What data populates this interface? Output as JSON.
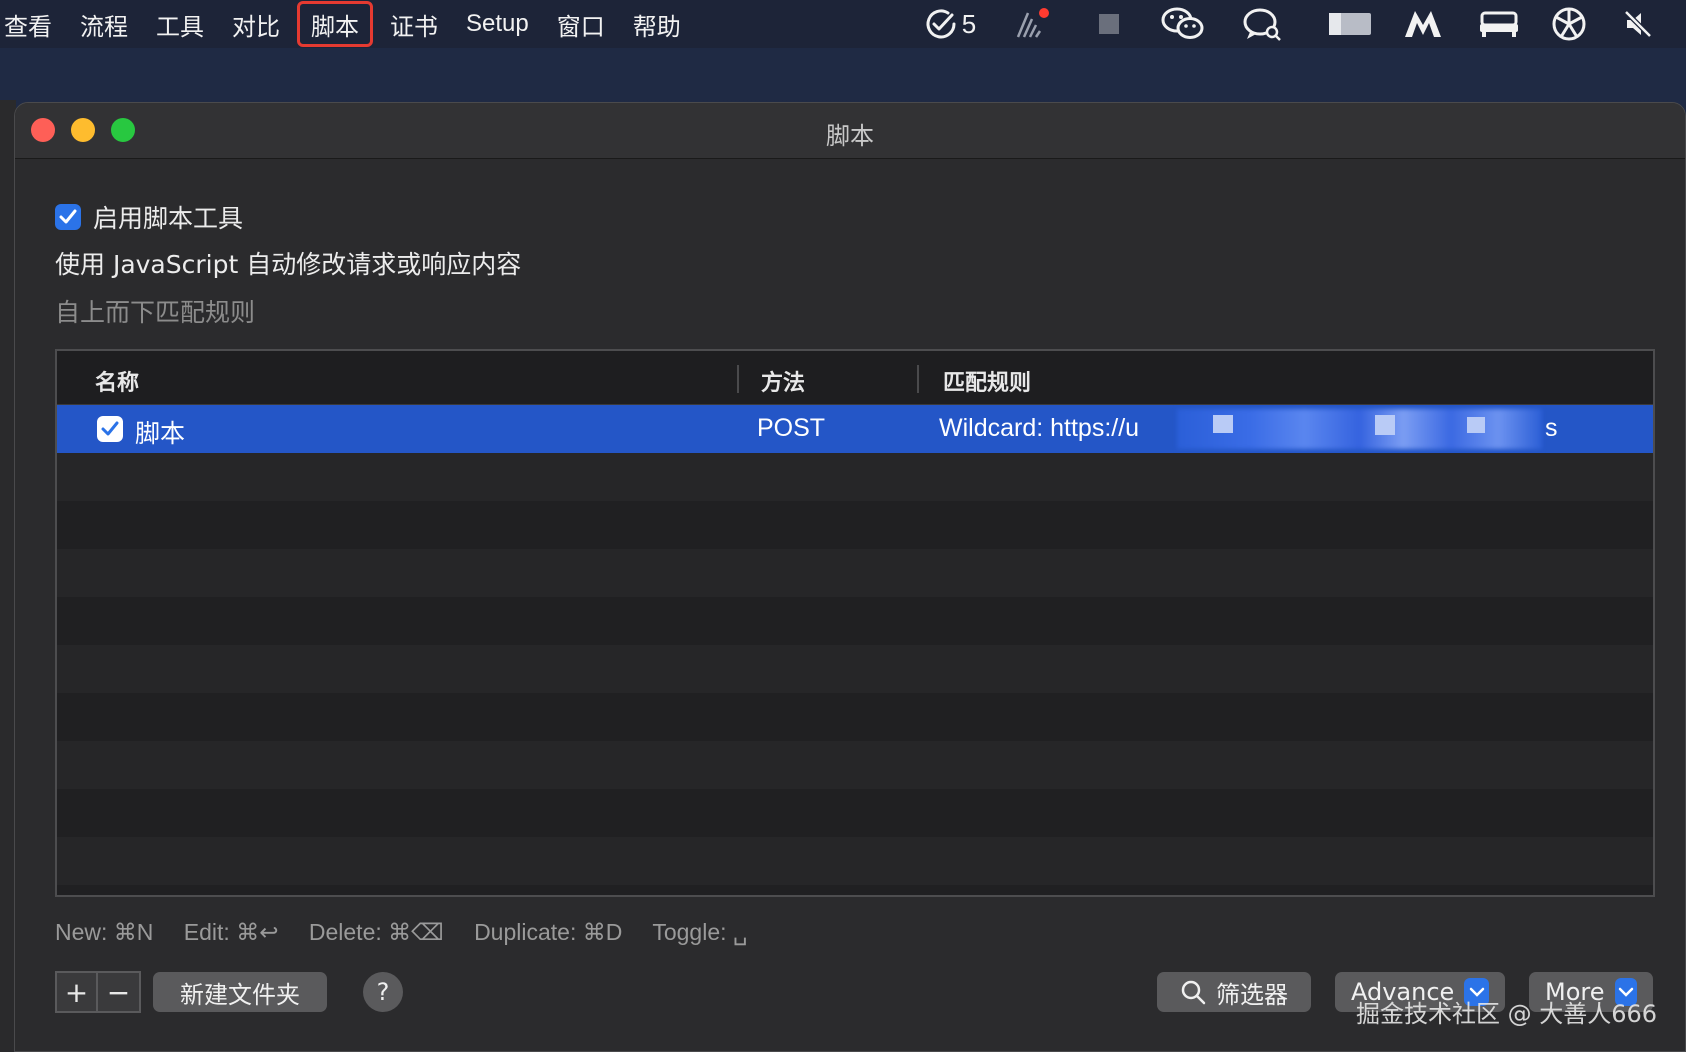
{
  "menubar": {
    "items": [
      "查看",
      "流程",
      "工具",
      "对比",
      "脚本",
      "证书",
      "Setup",
      "窗口",
      "帮助"
    ],
    "highlighted_index": 4,
    "tray_count": "5"
  },
  "window": {
    "title": "脚本",
    "enable_label": "启用脚本工具",
    "description": "使用 JavaScript 自动修改请求或响应内容",
    "order_hint": "自上而下匹配规则"
  },
  "table": {
    "headers": {
      "name": "名称",
      "method": "方法",
      "rule": "匹配规则"
    },
    "rows": [
      {
        "name": "脚本",
        "method": "POST",
        "rule_prefix": "Wildcard: https://u",
        "rule_suffix": "s",
        "enabled": true,
        "selected": true
      }
    ]
  },
  "shortcuts": {
    "new": "New: ⌘N",
    "edit": "Edit: ⌘↩",
    "delete": "Delete: ⌘⌫",
    "duplicate": "Duplicate: ⌘D",
    "toggle": "Toggle: ␣"
  },
  "footer": {
    "plus": "+",
    "minus": "−",
    "new_folder": "新建文件夹",
    "help": "?",
    "filter": "筛选器",
    "advance": "Advance",
    "more": "More"
  },
  "watermark": "掘金技术社区 @ 大善人666",
  "colors": {
    "accent": "#2b73e8",
    "selection": "#2456c7",
    "highlight_border": "#e53a31"
  }
}
